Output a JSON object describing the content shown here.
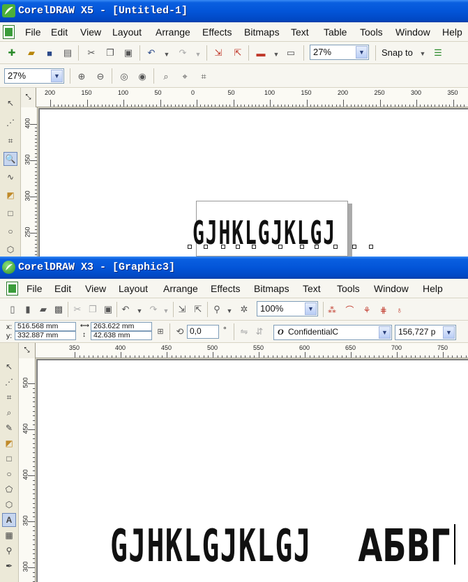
{
  "window1": {
    "title": "CorelDRAW X5 - [Untitled-1]",
    "menu": [
      "File",
      "Edit",
      "View",
      "Layout",
      "Arrange",
      "Effects",
      "Bitmaps",
      "Text",
      "Table",
      "Tools",
      "Window",
      "Help"
    ],
    "zoom": "27%",
    "snap_to": "Snap to",
    "hruler_labels": [
      "200",
      "150",
      "100",
      "50",
      "0",
      "50",
      "100",
      "150",
      "200",
      "250",
      "300",
      "350"
    ],
    "vruler_labels": [
      "400",
      "350",
      "300",
      "250"
    ],
    "artwork_text": "GJHKLGJKLGJ"
  },
  "window2": {
    "title": "CorelDRAW X3 - [Graphic3]",
    "menu": [
      "File",
      "Edit",
      "View",
      "Layout",
      "Arrange",
      "Effects",
      "Bitmaps",
      "Text",
      "Tools",
      "Window",
      "Help"
    ],
    "zoom": "100%",
    "prop": {
      "x_label": "x:",
      "x_value": "516.568 mm",
      "y_label": "y:",
      "y_value": "332.887 mm",
      "w_value": "263.622 mm",
      "h_value": "42.638 mm",
      "angle": "0,0",
      "degree": "°",
      "font": "ConfidentialC",
      "font_size": "156,727 p"
    },
    "hruler_labels": [
      "350",
      "400",
      "450",
      "500",
      "550",
      "600",
      "650",
      "700",
      "750"
    ],
    "vruler_labels": [
      "500",
      "450",
      "400",
      "350",
      "300"
    ],
    "artwork_text": "GJHKLGJKLGJ",
    "artwork_cyrillic": "АБВГ"
  },
  "colors": {
    "titlebar": "#0355d8",
    "canvas": "#ffffff",
    "chrome": "#ece9d8"
  },
  "icons": [
    "new-icon",
    "open-icon",
    "save-icon",
    "print-icon",
    "cut-icon",
    "copy-icon",
    "paste-icon",
    "undo-icon",
    "redo-icon",
    "import-icon",
    "export-icon",
    "zoom-in-icon",
    "zoom-out-icon",
    "pick-tool-icon",
    "shape-tool-icon",
    "crop-tool-icon",
    "zoom-tool-icon",
    "freehand-tool-icon",
    "fill-tool-icon",
    "rectangle-tool-icon",
    "ellipse-tool-icon",
    "polygon-tool-icon",
    "text-tool-icon",
    "eyedropper-tool-icon"
  ]
}
